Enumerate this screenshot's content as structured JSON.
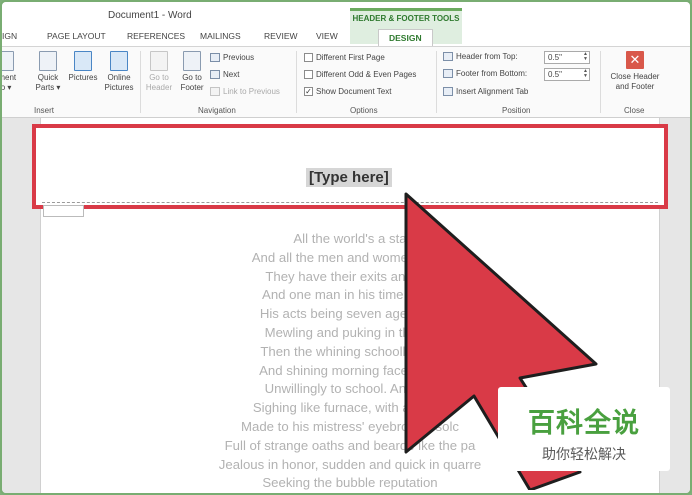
{
  "window": {
    "title": "Document1 - Word"
  },
  "contextual_tab_group": "HEADER & FOOTER TOOLS",
  "tabs": [
    "IGN",
    "PAGE LAYOUT",
    "REFERENCES",
    "MAILINGS",
    "REVIEW",
    "VIEW",
    "DESIGN"
  ],
  "ribbon": {
    "insert": {
      "group_label": "Insert",
      "buttons": [
        {
          "line1": "ument",
          "line2": "fo ▾",
          "icon": "document-info-icon"
        },
        {
          "line1": "Quick",
          "line2": "Parts ▾",
          "icon": "quick-parts-icon"
        },
        {
          "line1": "Pictures",
          "line2": "",
          "icon": "pictures-icon"
        },
        {
          "line1": "Online",
          "line2": "Pictures",
          "icon": "online-pictures-icon"
        }
      ]
    },
    "navigation": {
      "group_label": "Navigation",
      "buttons": [
        {
          "line1": "Go to",
          "line2": "Header",
          "icon": "go-to-header-icon",
          "dim": true
        },
        {
          "line1": "Go to",
          "line2": "Footer",
          "icon": "go-to-footer-icon",
          "dim": false
        }
      ],
      "previous": "Previous",
      "next": "Next",
      "link_to_previous": "Link to Previous"
    },
    "options": {
      "group_label": "Options",
      "different_first_page": {
        "label": "Different First Page",
        "checked": false
      },
      "different_odd_even": {
        "label": "Different Odd & Even Pages",
        "checked": false
      },
      "show_document_text": {
        "label": "Show Document Text",
        "checked": true
      }
    },
    "position": {
      "group_label": "Position",
      "header_from_top": {
        "label": "Header from Top:",
        "value": "0.5\""
      },
      "footer_from_bottom": {
        "label": "Footer from Bottom:",
        "value": "0.5\""
      },
      "insert_alignment_tab": "Insert Alignment Tab"
    },
    "close": {
      "group_label": "Close",
      "line1": "Close Header",
      "line2": "and Footer"
    }
  },
  "document": {
    "header_placeholder": "[Type here]",
    "poem_lines": [
      "All the world's a sta",
      "And all the men and women m                rs;",
      "They have their exits and the",
      "And one man in his time plays",
      "His acts being seven ages. At f",
      "Mewling and puking in the nu",
      "Then the whining schoolboy, w",
      "And shining morning face, cree",
      "Unwillingly to school. And the",
      "Sighing like furnace, with a w          alla",
      "Made to his mistress' eyebrow,          a solc",
      "Full of strange oaths and bearde          ike the pa",
      "Jealous in honor, sudden and quick in quarre",
      "Seeking the bubble reputation"
    ]
  },
  "watermark": {
    "main": "百科全说",
    "sub": "助你轻松解决"
  },
  "colors": {
    "highlight_red": "#d93a47",
    "contextual_green": "#2f7a2f",
    "watermark_green": "#49a03f"
  }
}
